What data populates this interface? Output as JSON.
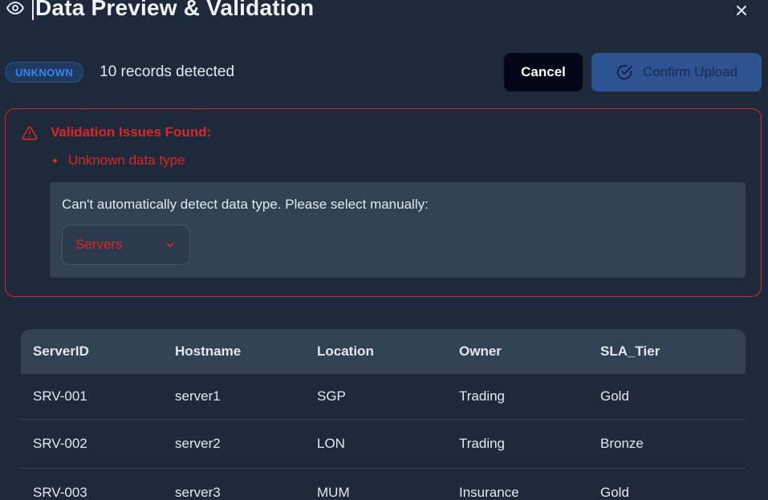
{
  "header": {
    "title": "Data Preview & Validation"
  },
  "status": {
    "badge": "UNKNOWN",
    "records": "10 records detected"
  },
  "actions": {
    "cancel_label": "Cancel",
    "confirm_label": "Confirm Upload"
  },
  "alert": {
    "title": "Validation Issues Found:",
    "issues": [
      "Unknown data type"
    ],
    "manual_text": "Can't automatically detect data type. Please select manually:",
    "select_value": "Servers"
  },
  "table": {
    "columns": [
      "ServerID",
      "Hostname",
      "Location",
      "Owner",
      "SLA_Tier"
    ],
    "rows": [
      [
        "SRV-001",
        "server1",
        "SGP",
        "Trading",
        "Gold"
      ],
      [
        "SRV-002",
        "server2",
        "LON",
        "Trading",
        "Bronze"
      ],
      [
        "SRV-003",
        "server3",
        "MUM",
        "Insurance",
        "Gold"
      ]
    ]
  },
  "colors": {
    "background": "#1e293b",
    "error": "#dc2626",
    "accent": "#3b82f6",
    "confirm_button": "#2f5597",
    "panel": "#334155"
  },
  "icons": {
    "title_icon": "eye-icon",
    "close": "close-icon",
    "alert": "warning-triangle-icon",
    "confirm": "check-circle-icon",
    "select": "chevron-down-icon"
  }
}
